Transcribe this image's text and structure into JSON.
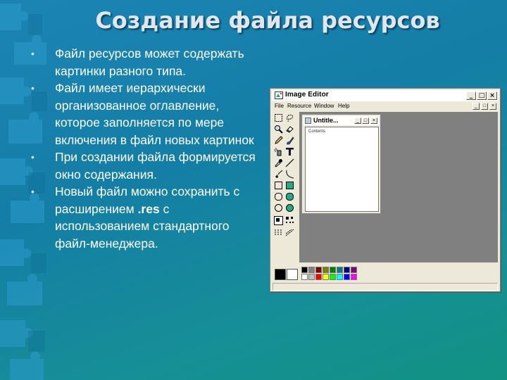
{
  "slide": {
    "title": "Создание файла ресурсов",
    "bullet_glyph": "•",
    "bullets": [
      "Файл ресурсов может содержать картинки разного типа.",
      "Файл имеет иерархически организованное оглавление, которое заполняется по мере включения в файл новых картинок",
      "При создании файла формируется окно содержания.",
      "Новый файл можно сохранить с расширением ",
      ".res",
      " с использованием стандартного файл-менеджера."
    ]
  },
  "window": {
    "title": "Image Editor",
    "menu": [
      "File",
      "Resource",
      "Window",
      "Help"
    ],
    "controls": {
      "minimize": "_",
      "maximize": "□",
      "close": "×"
    },
    "child": {
      "title": "Untitle...",
      "tree_item": "Contents",
      "controls": {
        "minimize": "_",
        "maximize": "□",
        "close": "×"
      }
    },
    "palette": {
      "foreground": "#000000",
      "background": "#ffffff",
      "colors_top": [
        "#000000",
        "#808080",
        "#800000",
        "#808000",
        "#008000",
        "#008080",
        "#000080",
        "#800080"
      ],
      "colors_bottom": [
        "#ffffff",
        "#c0c0c0",
        "#ff0000",
        "#ffff00",
        "#00ff00",
        "#00ffff",
        "#0000ff",
        "#ff00ff"
      ]
    },
    "tools": [
      "marquee-icon",
      "lasso-icon",
      "zoom-icon",
      "eraser-icon",
      "pen-icon",
      "brush-icon",
      "airbrush-icon",
      "text-icon",
      "dropper-icon",
      "line-icon",
      "curve-icon",
      "rectangle-icon",
      "filled-rectangle-icon",
      "ellipse-icon",
      "filled-ellipse-icon",
      "circle-icon",
      "filled-circle-icon",
      "brush-size-icon",
      "line-style-icon"
    ]
  }
}
